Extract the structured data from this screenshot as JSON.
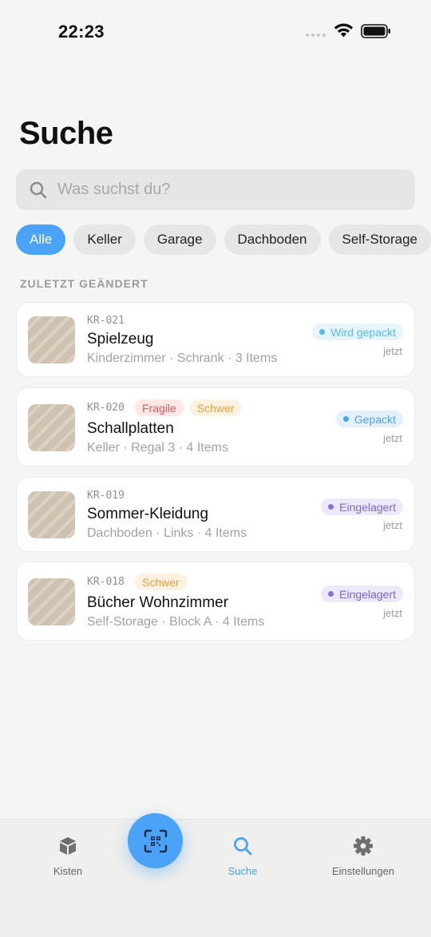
{
  "status_bar": {
    "time": "22:23"
  },
  "page_title": "Suche",
  "search": {
    "placeholder": "Was suchst du?",
    "value": ""
  },
  "filters": [
    "Alle",
    "Keller",
    "Garage",
    "Dachboden",
    "Self-Storage"
  ],
  "active_filter": "Alle",
  "section_label": "ZULETZT GEÄNDERT",
  "boxes": [
    {
      "id": "KR-021",
      "name": "Spielzeug",
      "meta": "Kinderzimmer · Schrank · 3 Items",
      "tags": [],
      "status": "Wird gepackt",
      "status_color": "#5bb8ea",
      "time": "jetzt"
    },
    {
      "id": "KR-020",
      "name": "Schallplatten",
      "meta": "Keller · Regal 3 · 4 Items",
      "tags": [
        {
          "label": "Fragile",
          "color": "#e05a5a",
          "bg": "#fde7e7"
        },
        {
          "label": "Schwer",
          "color": "#eaa03c",
          "bg": "#fdf1e0"
        }
      ],
      "status": "Gepackt",
      "status_color": "#4ba3f7",
      "time": "jetzt"
    },
    {
      "id": "KR-019",
      "name": "Sommer-Kleidung",
      "meta": "Dachboden · Links · 4 Items",
      "tags": [],
      "status": "Eingelagert",
      "status_color": "#8a6fe0",
      "time": "jetzt"
    },
    {
      "id": "KR-018",
      "name": "Bücher Wohnzimmer",
      "meta": "Self-Storage · Block A · 4 Items",
      "tags": [
        {
          "label": "Schwer",
          "color": "#eaa03c",
          "bg": "#fdf1e0"
        }
      ],
      "status": "Eingelagert",
      "status_color": "#8a6fe0",
      "time": "jetzt"
    }
  ],
  "tab_bar": {
    "kisten": "Kisten",
    "suche": "Suche",
    "einstellungen": "Einstellungen",
    "active": "Suche"
  },
  "colors": {
    "accent": "#4ba3f7",
    "background": "#f5f5f3"
  }
}
